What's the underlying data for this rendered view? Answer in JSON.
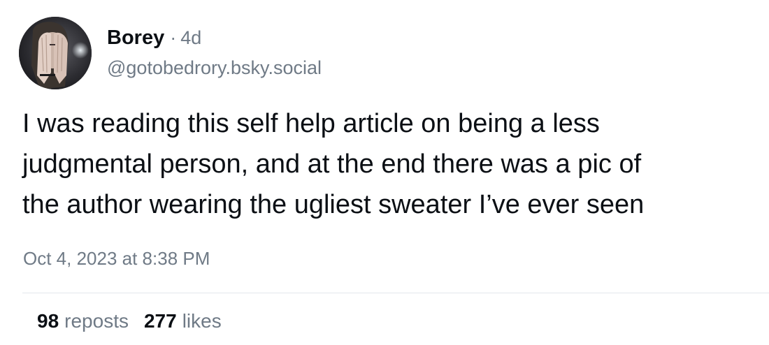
{
  "post": {
    "author": {
      "display_name": "Borey",
      "handle": "@gotobedrory.bsky.social",
      "separator": "·",
      "relative_time": "4d"
    },
    "text_lines": [
      "I was reading this self help article on being a less",
      "judgmental person, and at the end there was a pic of",
      "the author wearing the ugliest sweater I’ve ever seen"
    ],
    "posted_at": "Oct 4, 2023 at 8:38 PM",
    "stats": {
      "reposts_count": "98",
      "reposts_label": "reposts",
      "likes_count": "277",
      "likes_label": "likes"
    }
  },
  "colors": {
    "text_primary": "#0b0f14",
    "text_secondary": "#6f7a86",
    "divider": "#e3e7eb",
    "background": "#ffffff"
  }
}
